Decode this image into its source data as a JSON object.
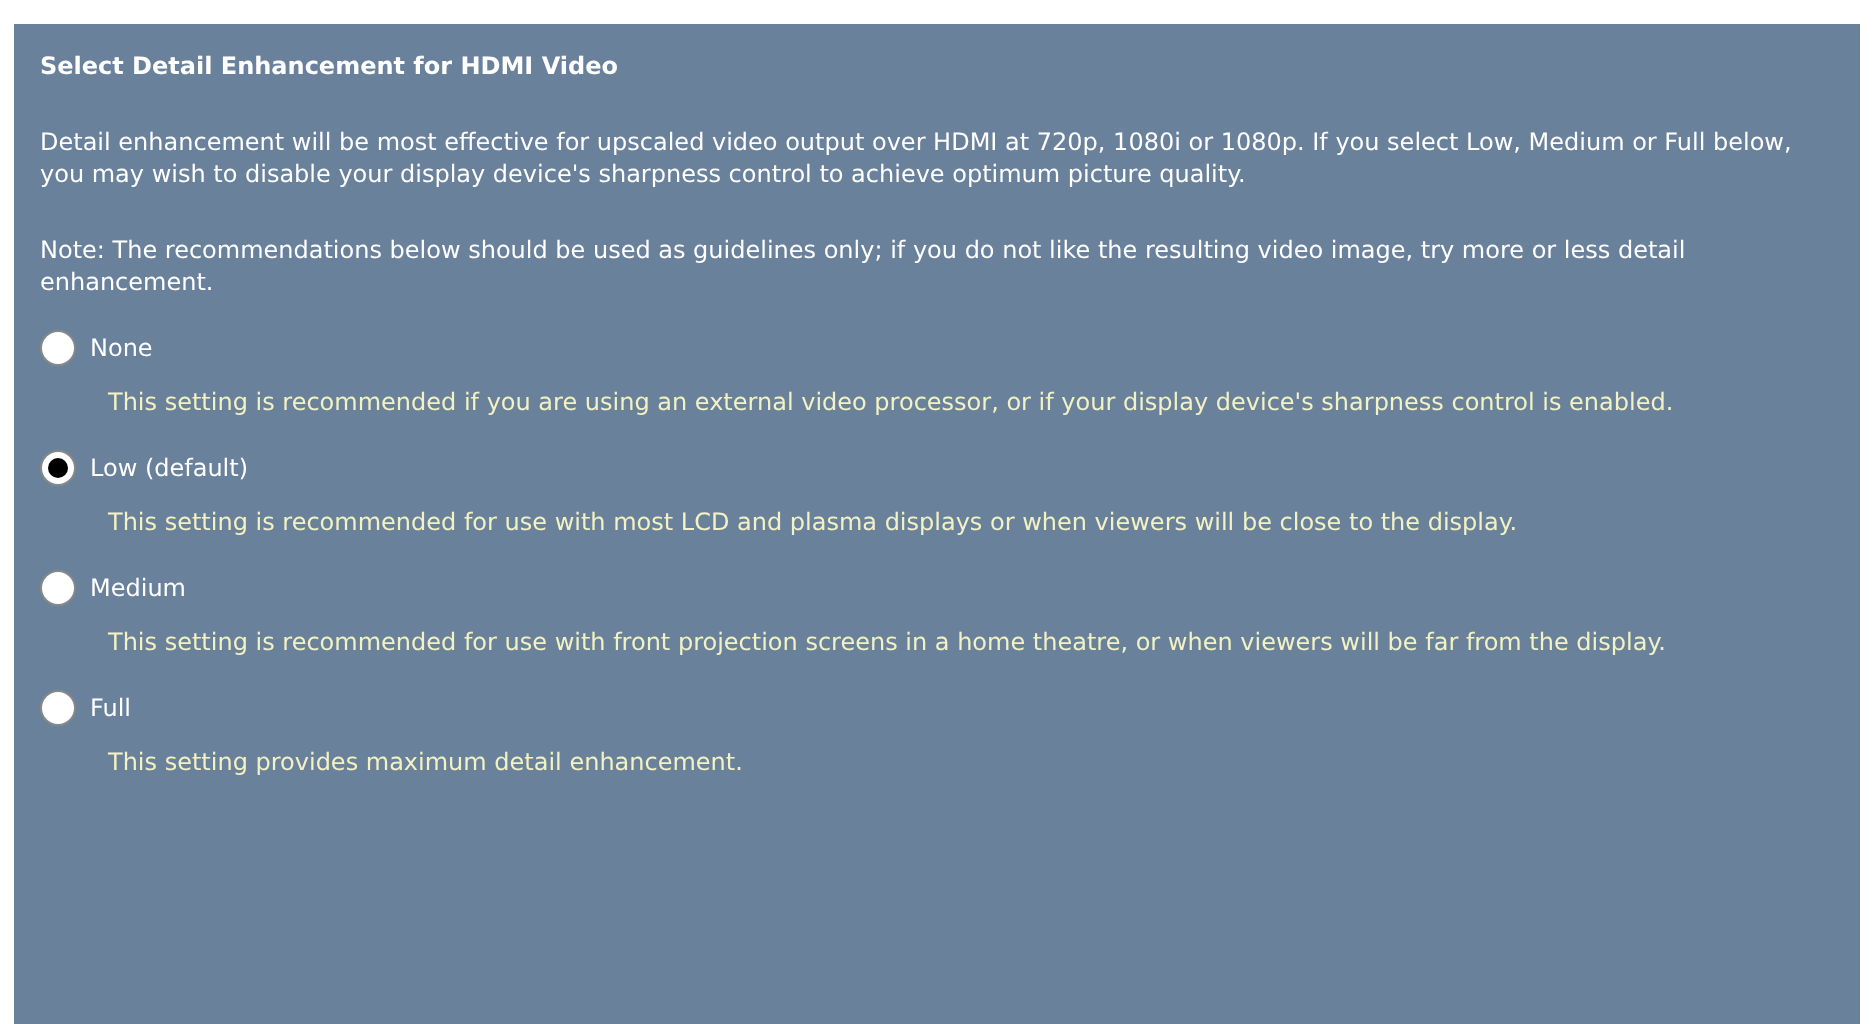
{
  "title": "Select Detail Enhancement for HDMI Video",
  "paragraphs": [
    "Detail enhancement will be most effective for upscaled video output over HDMI at 720p, 1080i or 1080p. If you select Low, Medium or Full below, you may wish to disable your display device's sharpness control to achieve optimum picture quality.",
    "Note: The recommendations below should be used as guidelines only; if you do not like the resulting video image, try more or less detail enhancement."
  ],
  "options": [
    {
      "label": "None",
      "selected": false,
      "description": "This setting is recommended if you are using an external video processor, or if your display device's sharpness control is enabled."
    },
    {
      "label": "Low (default)",
      "selected": true,
      "description": "This setting is recommended for use with most LCD and plasma displays or when viewers will be close to the display."
    },
    {
      "label": "Medium",
      "selected": false,
      "description": "This setting is recommended for use with front projection screens in a home theatre, or when viewers will be far from the display."
    },
    {
      "label": "Full",
      "selected": false,
      "description": "This setting provides maximum detail enhancement."
    }
  ]
}
